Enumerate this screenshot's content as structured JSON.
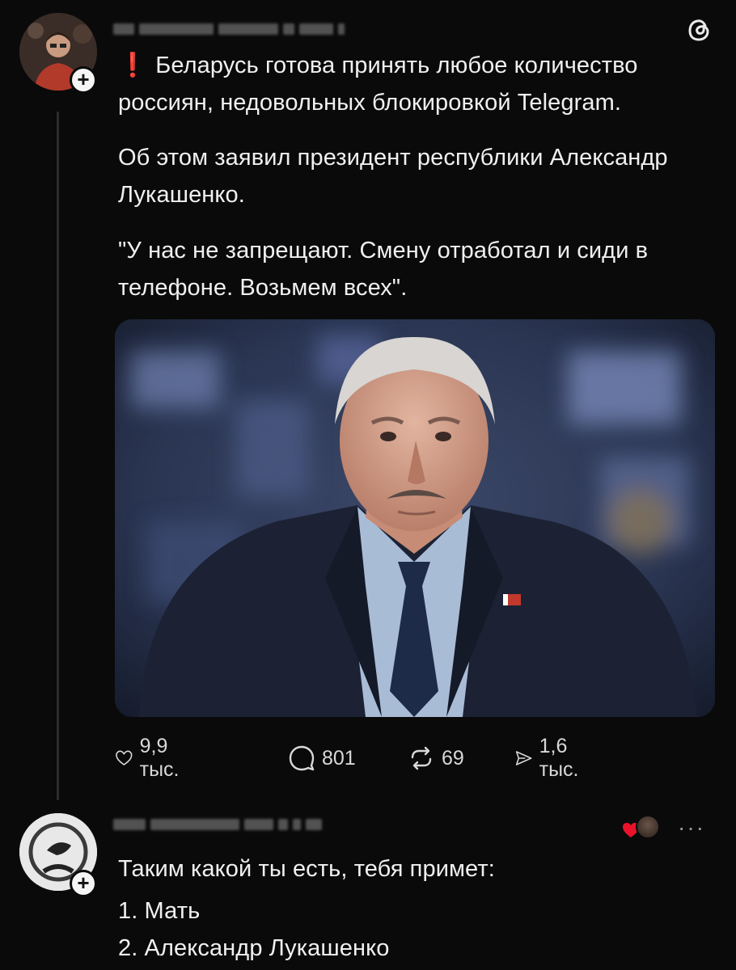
{
  "post": {
    "line1_prefix": "❗",
    "line1": "Беларусь готова принять любое количество россиян, недовольных блокировкой Telegram.",
    "paragraph2": "Об этом заявил президент республики Александр Лукашенко.",
    "paragraph3": "\"У нас не запрещают. Смену отработал и сиди в телефоне. Возьмем всех\".",
    "stats": {
      "likes": "9,9 тыс.",
      "replies": "801",
      "reposts": "69",
      "shares": "1,6 тыс."
    }
  },
  "reply": {
    "line1": "Таким какой ты есть, тебя примет:",
    "line2": "1. Мать",
    "line3": "2. Александр Лукашенко"
  },
  "icons": {
    "app_logo": "threads-logo-icon",
    "like": "heart-icon",
    "reply": "comment-icon",
    "repost": "repost-icon",
    "share": "send-icon",
    "more": "more-icon",
    "follow": "plus-icon"
  },
  "colors": {
    "background": "#0a0a0a",
    "text": "#f0f0f0",
    "alert": "#e8132a",
    "secondary": "#d8d8d8"
  }
}
